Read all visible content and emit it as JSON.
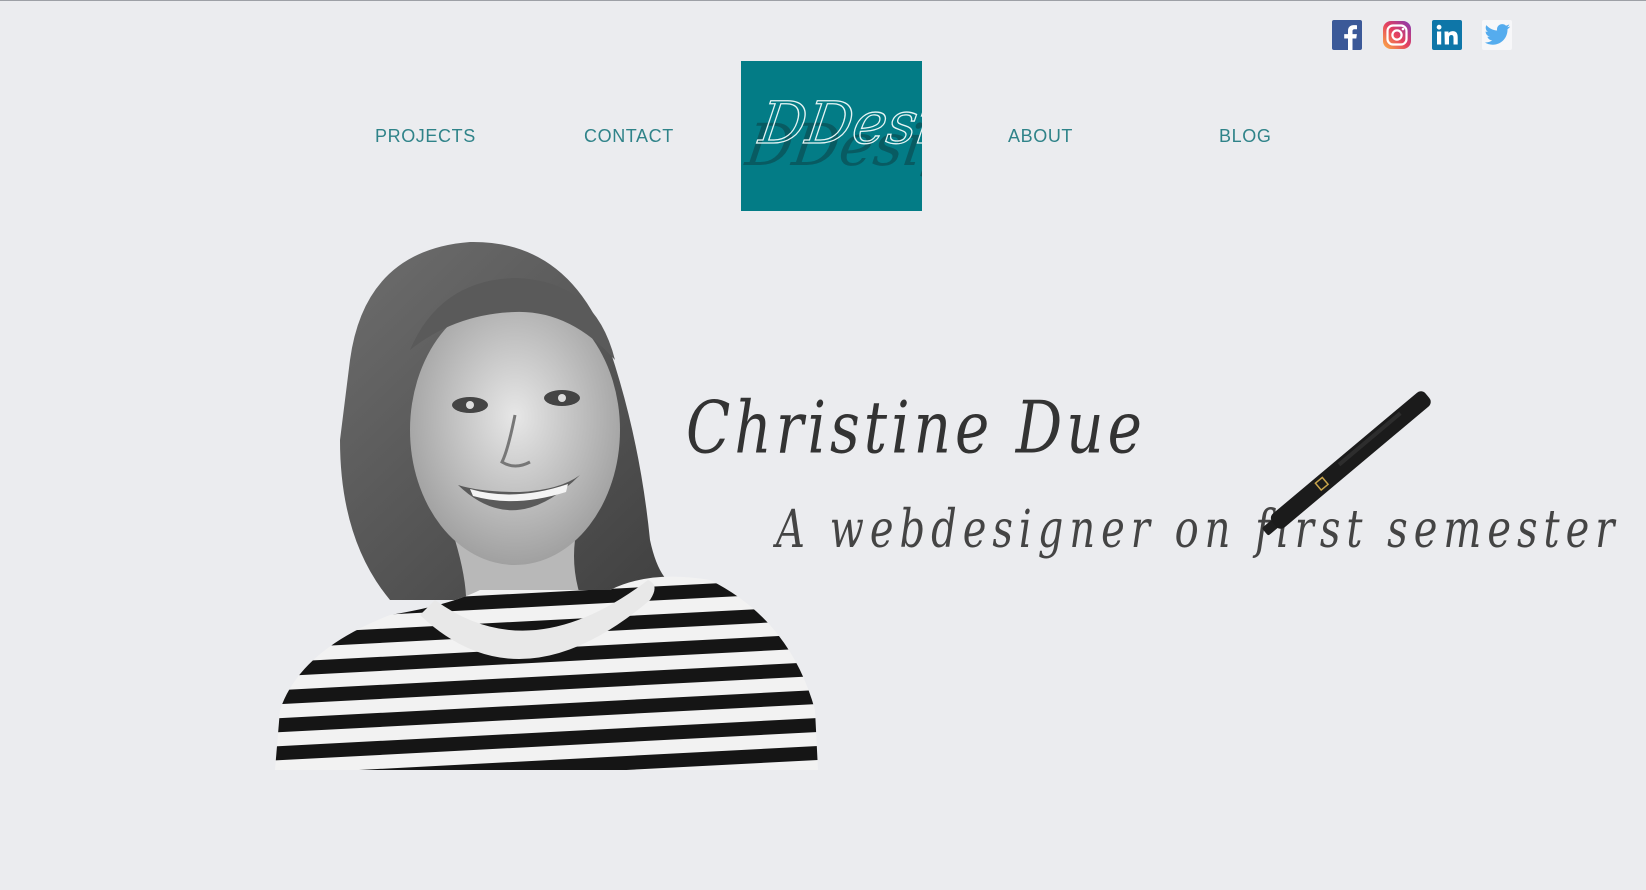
{
  "social": [
    {
      "name": "facebook-icon",
      "color": "#3b5998"
    },
    {
      "name": "instagram-icon",
      "color": "#c13584"
    },
    {
      "name": "linkedin-icon",
      "color": "#0e76a8"
    },
    {
      "name": "twitter-icon",
      "color": "#55acee"
    }
  ],
  "nav": {
    "projects": "PROJECTS",
    "contact": "CONTACT",
    "about": "ABOUT",
    "blog": "BLOG"
  },
  "logo": {
    "text": "DDesign",
    "background": "#037c86"
  },
  "hero": {
    "name": "Christine Due",
    "tagline": "A webdesigner on first semester"
  },
  "colors": {
    "background": "#ebecef",
    "nav_text": "#2f8389"
  }
}
